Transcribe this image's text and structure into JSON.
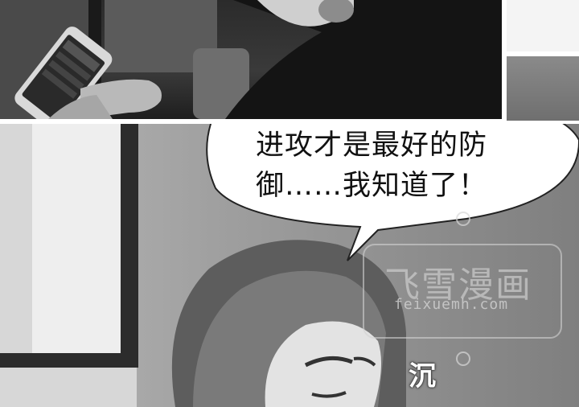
{
  "speech_bubble": {
    "line1": "进攻才是最好的防",
    "line2": "御……我知道了！"
  },
  "sound_effect": "沉",
  "watermark": {
    "title": "飞雪漫画",
    "url": "feixuemh.com"
  }
}
